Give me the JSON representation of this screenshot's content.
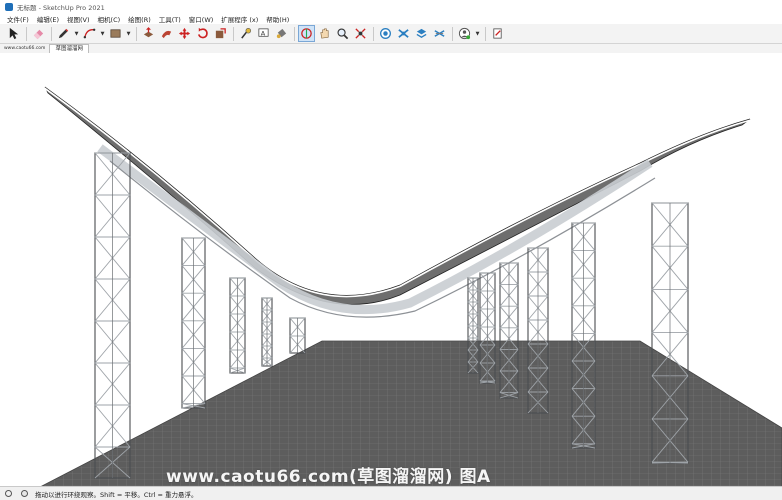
{
  "window": {
    "title": "无标题 - SketchUp Pro 2021"
  },
  "menu": [
    "文件(F)",
    "编辑(E)",
    "视图(V)",
    "相机(C)",
    "绘图(R)",
    "工具(T)",
    "窗口(W)",
    "扩展程序 (x)",
    "帮助(H)"
  ],
  "scene": {
    "watermark": "www.caotu66.com",
    "tab_label": "草图溜溜网"
  },
  "status": {
    "hint": "拖动以进行环绕观察。Shift = 平移。Ctrl = 重力悬浮。"
  },
  "overlay": {
    "watermark_text": "www.caotu66.com(草图溜溜网) 图A"
  },
  "toolbar": {
    "tools": [
      "select-icon",
      "eraser-icon",
      "pencil-icon",
      "arc-icon",
      "rectangle-icon",
      "push-pull-icon",
      "follow-me-icon",
      "move-icon",
      "rotate-icon",
      "scale-icon",
      "tape-measure-icon",
      "text-icon",
      "paint-bucket-icon",
      "orbit-icon",
      "pan-icon",
      "zoom-icon",
      "zoom-extents-icon",
      "warehouse-icon",
      "extension-warehouse-icon",
      "layout-icon",
      "component-icon",
      "account-icon",
      "profile-icon"
    ],
    "active_tool": "orbit-icon"
  },
  "colors": {
    "floor": "#5e5e5e",
    "roof": "#6f6f6f",
    "truss": "#cfd3d6",
    "sky": "#ffffff"
  }
}
